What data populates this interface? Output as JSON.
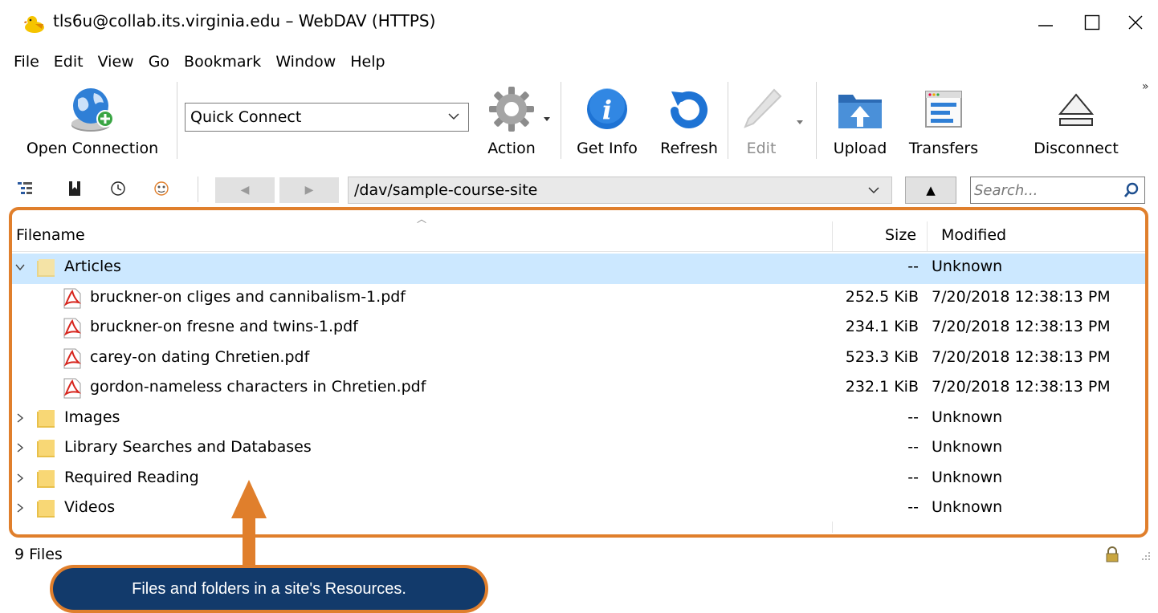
{
  "window": {
    "title": "tls6u@collab.its.virginia.edu – WebDAV (HTTPS)",
    "app_icon": "cyberduck-icon",
    "controls": [
      "minimize-icon",
      "maximize-icon",
      "close-icon"
    ]
  },
  "menu": [
    "File",
    "Edit",
    "View",
    "Go",
    "Bookmark",
    "Window",
    "Help"
  ],
  "toolbar": {
    "open_connection": "Open Connection",
    "quick_connect": "Quick Connect",
    "action": "Action",
    "get_info": "Get Info",
    "refresh": "Refresh",
    "edit": "Edit",
    "upload": "Upload",
    "transfers": "Transfers",
    "disconnect": "Disconnect"
  },
  "navigation": {
    "path": "/dav/sample-course-site",
    "search_placeholder": "Search...",
    "icons": [
      "browser-view-icon",
      "bookmarks-icon",
      "history-icon",
      "bonjour-icon",
      "back-arrow-icon",
      "forward-arrow-icon",
      "parent-folder-icon",
      "search-icon"
    ]
  },
  "columns": {
    "filename": "Filename",
    "size": "Size",
    "modified": "Modified"
  },
  "files": [
    {
      "name": "Articles",
      "type": "folder",
      "expanded": true,
      "depth": 0,
      "size": "--",
      "modified": "Unknown",
      "selected": true
    },
    {
      "name": "bruckner-on cliges and cannibalism-1.pdf",
      "type": "pdf",
      "depth": 1,
      "size": "252.5 KiB",
      "modified": "7/20/2018 12:38:13 PM"
    },
    {
      "name": "bruckner-on fresne and twins-1.pdf",
      "type": "pdf",
      "depth": 1,
      "size": "234.1 KiB",
      "modified": "7/20/2018 12:38:13 PM"
    },
    {
      "name": "carey-on dating Chretien.pdf",
      "type": "pdf",
      "depth": 1,
      "size": "523.3 KiB",
      "modified": "7/20/2018 12:38:13 PM"
    },
    {
      "name": "gordon-nameless characters in Chretien.pdf",
      "type": "pdf",
      "depth": 1,
      "size": "232.1 KiB",
      "modified": "7/20/2018 12:38:13 PM"
    },
    {
      "name": "Images",
      "type": "folder",
      "expanded": false,
      "depth": 0,
      "size": "--",
      "modified": "Unknown"
    },
    {
      "name": "Library Searches and Databases",
      "type": "folder",
      "expanded": false,
      "depth": 0,
      "size": "--",
      "modified": "Unknown"
    },
    {
      "name": "Required Reading",
      "type": "folder",
      "expanded": false,
      "depth": 0,
      "size": "--",
      "modified": "Unknown"
    },
    {
      "name": "Videos",
      "type": "folder",
      "expanded": false,
      "depth": 0,
      "size": "--",
      "modified": "Unknown"
    }
  ],
  "status": {
    "text": "9 Files",
    "icon": "lock-icon"
  },
  "callout": {
    "text": "Files and folders in a site's Resources."
  },
  "colors": {
    "highlight": "#e07f2c",
    "callout_bg": "#123a6b",
    "selected_row": "#cce8ff"
  }
}
